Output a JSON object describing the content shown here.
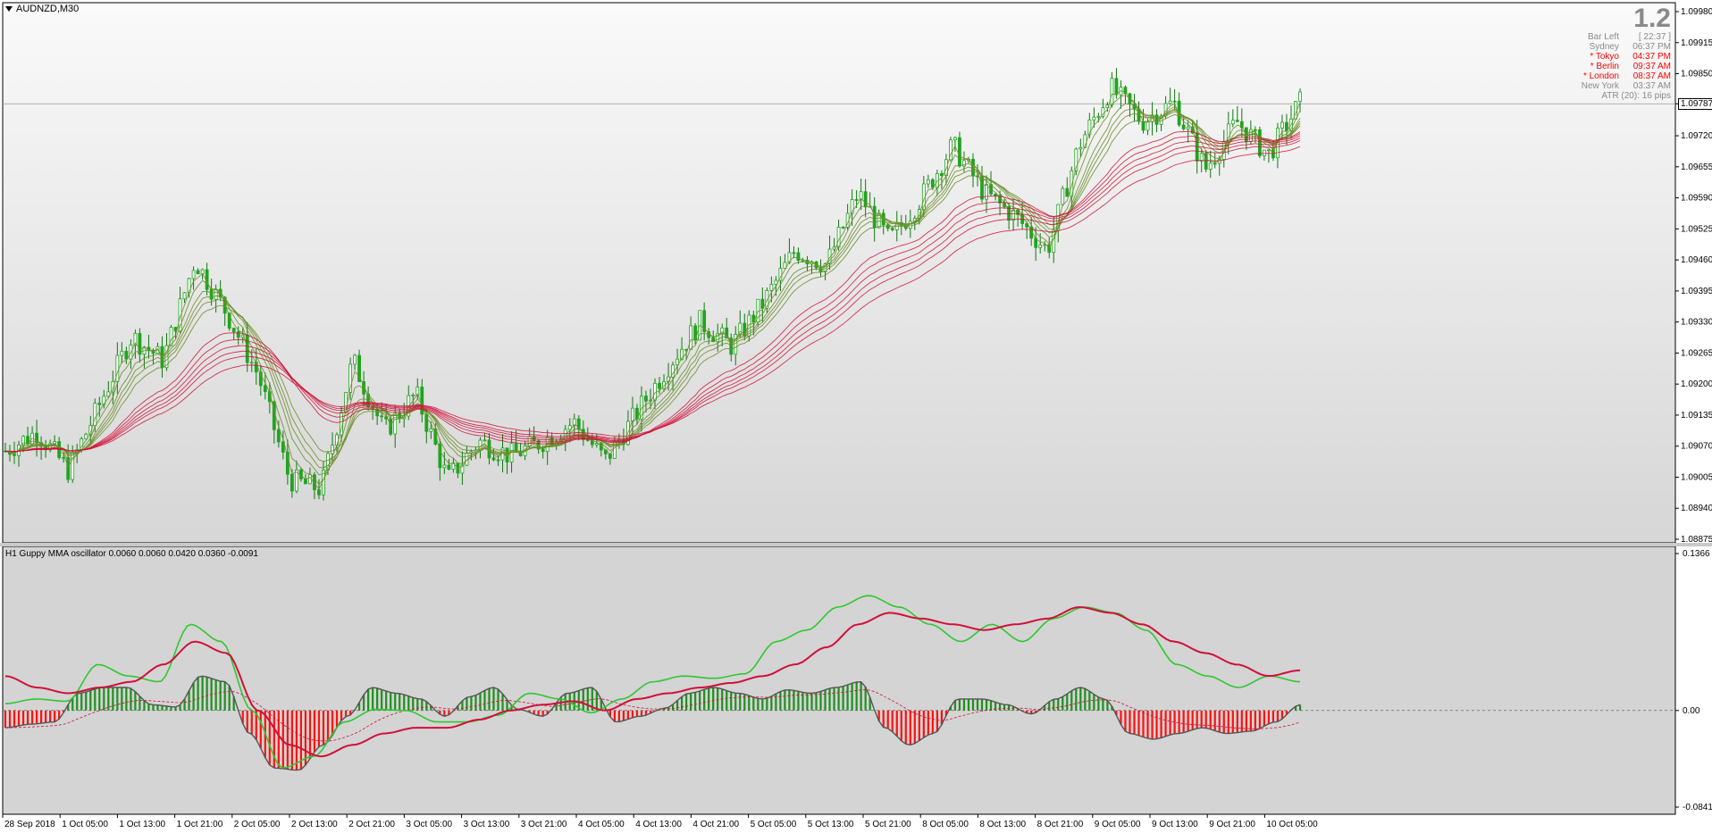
{
  "window": {
    "symbol_label": "AUDNZD,M30",
    "oscillator_label": "H1 Guppy MMA oscillator 0.0060 0.0060 0.0420 0.0360 -0.0091"
  },
  "info_panel": {
    "big_value": "1.2",
    "rows": [
      {
        "k": "Bar Left",
        "v": "[ 22:37 ]",
        "color": "gray"
      },
      {
        "k": "Sydney",
        "v": "06:37 PM",
        "color": "gray"
      },
      {
        "k": "* Tokyo",
        "v": "04:37 PM",
        "color": "red"
      },
      {
        "k": "* Berlin",
        "v": "09:37 AM",
        "color": "red"
      },
      {
        "k": "* London",
        "v": "08:37 AM",
        "color": "red"
      },
      {
        "k": "New York",
        "v": "03:37 AM",
        "color": "gray"
      },
      {
        "k": "ATR (20): 16 pips",
        "v": "",
        "color": "gray"
      }
    ]
  },
  "colors": {
    "candle": "#1fa51f",
    "candle_wick": "#0f7a0f",
    "mma_short": "#6b8f2a",
    "mma_long": "#d0103a",
    "osc_green": "#2ec82e",
    "osc_red_line": "#d0103a",
    "hist_pos": "#1f8f1f",
    "hist_neg": "#ff1010",
    "bg_top": "#fafafa",
    "bg_bottom": "#d6d6d6"
  },
  "chart_data": [
    {
      "type": "line",
      "title": "AUDNZD,M30",
      "y_axis_ticks": [
        "1.09980",
        "1.09915",
        "1.09850",
        "1.09787",
        "1.09720",
        "1.09655",
        "1.09590",
        "1.09525",
        "1.09460",
        "1.09395",
        "1.09330",
        "1.09265",
        "1.09200",
        "1.09135",
        "1.09070",
        "1.09005",
        "1.08940",
        "1.08875"
      ],
      "current_price": "1.09787",
      "ylim": [
        1.08875,
        1.0998
      ],
      "x_tick_labels": [
        "28 Sep 2018",
        "1 Oct 05:00",
        "1 Oct 13:00",
        "1 Oct 21:00",
        "2 Oct 05:00",
        "2 Oct 13:00",
        "2 Oct 21:00",
        "3 Oct 05:00",
        "3 Oct 13:00",
        "3 Oct 21:00",
        "4 Oct 05:00",
        "4 Oct 13:00",
        "4 Oct 21:00",
        "5 Oct 05:00",
        "5 Oct 13:00",
        "5 Oct 21:00",
        "8 Oct 05:00",
        "8 Oct 13:00",
        "8 Oct 21:00",
        "9 Oct 05:00",
        "9 Oct 13:00",
        "9 Oct 21:00",
        "10 Oct 05:00"
      ],
      "series": [
        {
          "values": [
            1.0906,
            1.091,
            1.0902,
            1.0916,
            1.093,
            1.0925,
            1.0946,
            1.0935,
            1.0922,
            1.09,
            1.0898,
            1.0925,
            1.091,
            1.0918,
            1.09,
            1.0908,
            1.0905,
            1.0908,
            1.0912,
            1.0904,
            1.0914,
            1.0924,
            1.0933,
            1.0928,
            1.0937,
            1.0948,
            1.0945,
            1.096,
            1.095,
            1.0959,
            1.097,
            1.096,
            1.0955,
            1.0948,
            1.097,
            1.0982,
            1.0975,
            1.0979,
            1.0965,
            1.0975,
            1.0968,
            1.0979
          ]
        }
      ]
    },
    {
      "type": "bar",
      "title": "H1 Guppy MMA oscillator 0.0060 0.0060 0.0420 0.0360 -0.0091",
      "y_axis_ticks": [
        "0.1366",
        "0.00",
        "-0.0841"
      ],
      "ylim": [
        -0.0841,
        0.1366
      ],
      "histogram": [
        -0.015,
        -0.012,
        -0.01,
        0.015,
        0.02,
        0.02,
        0.005,
        0.003,
        0.03,
        0.025,
        -0.02,
        -0.05,
        -0.052,
        -0.03,
        -0.005,
        0.02,
        0.015,
        0.01,
        -0.005,
        0.012,
        0.02,
        0.001,
        -0.005,
        0.015,
        0.02,
        -0.01,
        -0.005,
        0.002,
        0.015,
        0.02,
        0.015,
        0.01,
        0.018,
        0.015,
        0.02,
        0.025,
        -0.015,
        -0.03,
        -0.02,
        0.01,
        0.01,
        0.005,
        -0.003,
        0.01,
        0.02,
        0.01,
        -0.02,
        -0.025,
        -0.02,
        -0.015,
        -0.02,
        -0.018,
        -0.01,
        0.005
      ],
      "fast_line": [
        0.006,
        0.01,
        0.008,
        0.04,
        0.03,
        0.025,
        0.075,
        0.06,
        0.0,
        -0.05,
        -0.04,
        -0.01,
        0.001,
        0.0,
        -0.01,
        -0.01,
        -0.004,
        0.015,
        0.01,
        -0.002,
        0.01,
        0.025,
        0.03,
        0.028,
        0.032,
        0.06,
        0.07,
        0.09,
        0.1,
        0.09,
        0.075,
        0.06,
        0.075,
        0.06,
        0.08,
        0.09,
        0.085,
        0.07,
        0.04,
        0.03,
        0.02,
        0.03,
        0.025
      ],
      "slow_line": [
        0.03,
        0.02,
        0.015,
        0.02,
        0.025,
        0.04,
        0.06,
        0.05,
        0.0,
        -0.03,
        -0.04,
        -0.03,
        -0.02,
        -0.015,
        -0.015,
        -0.008,
        0.0,
        0.005,
        0.008,
        0.0,
        0.01,
        0.015,
        0.02,
        0.024,
        0.03,
        0.04,
        0.055,
        0.075,
        0.085,
        0.08,
        0.075,
        0.07,
        0.075,
        0.08,
        0.09,
        0.085,
        0.075,
        0.06,
        0.05,
        0.04,
        0.03,
        0.035
      ]
    }
  ]
}
